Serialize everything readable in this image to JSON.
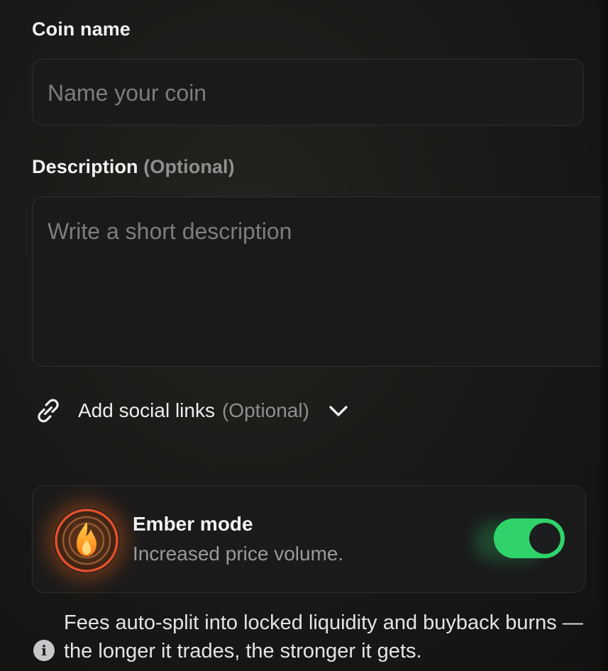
{
  "form": {
    "coin_name": {
      "label": "Coin name",
      "placeholder": "Name your coin"
    },
    "description": {
      "label": "Description",
      "optional_tag": "(Optional)",
      "placeholder": "Write a short description"
    },
    "social_links": {
      "label": "Add social links",
      "optional_tag": "(Optional)",
      "icon": "link-icon",
      "expand_icon": "chevron-down-icon"
    },
    "ember_mode": {
      "title": "Ember mode",
      "subtitle": "Increased price volume.",
      "enabled": true,
      "icon": "flame-icon",
      "accent": "#2fd36a"
    },
    "info": {
      "icon": "info-icon",
      "text": "Fees auto-split into locked liquidity and buyback burns — the longer it trades, the stronger it gets."
    }
  }
}
